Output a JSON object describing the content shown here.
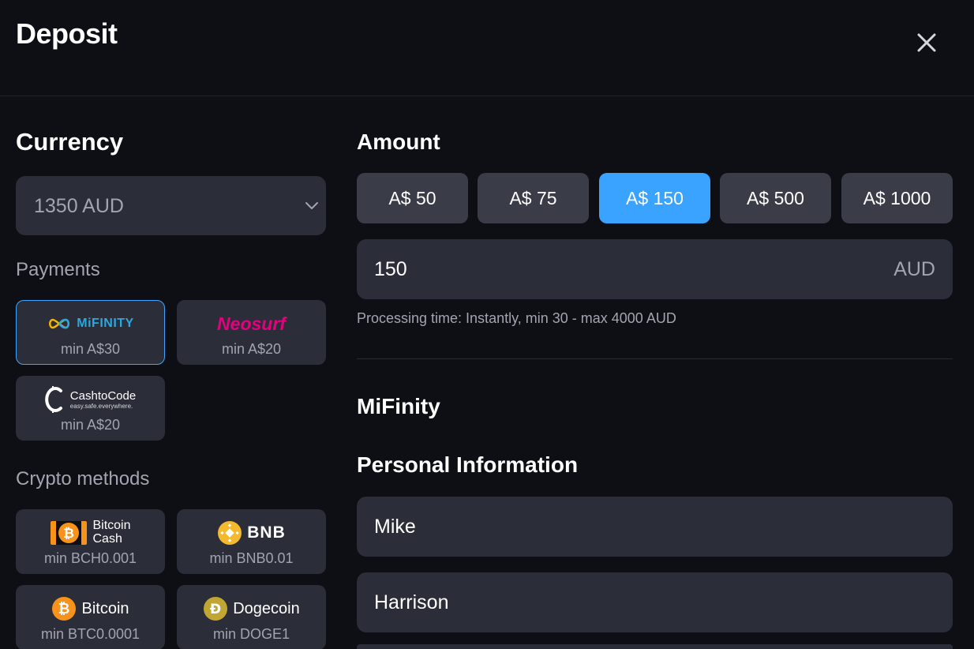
{
  "header": {
    "title": "Deposit",
    "close_icon": "close-icon"
  },
  "currency": {
    "heading": "Currency",
    "selected": "1350 AUD",
    "icon": "chevron-down-icon"
  },
  "payments": {
    "heading": "Payments",
    "methods": [
      {
        "logo_text": "MiFINITY",
        "min": "min A$30",
        "selected": true,
        "color": "#2aa8e0"
      },
      {
        "logo_text": "Neosurf",
        "min": "min A$20",
        "selected": false,
        "color": "#e5007e"
      },
      {
        "logo_text": "CashtoCode",
        "logo_subtext": "easy.safe.everywhere.",
        "min": "min A$20",
        "selected": false
      }
    ]
  },
  "crypto": {
    "heading": "Crypto methods",
    "methods": [
      {
        "logo_text_line1": "Bitcoin",
        "logo_text_line2": "Cash",
        "min": "min BCH0.001",
        "color": "#f7931a"
      },
      {
        "logo_text": "BNB",
        "min": "min BNB0.01",
        "color": "#f3ba2f"
      },
      {
        "logo_text": "Bitcoin",
        "min": "min BTC0.0001",
        "color": "#f7931a"
      },
      {
        "logo_text": "Dogecoin",
        "min": "min DOGE1",
        "color": "#c2a633"
      }
    ]
  },
  "amount": {
    "heading": "Amount",
    "presets": [
      "A$ 50",
      "A$ 75",
      "A$ 150",
      "A$ 500",
      "A$ 1000"
    ],
    "active_index": 2,
    "value": "150",
    "currency_suffix": "AUD",
    "hint": "Processing time: Instantly, min 30 - max 4000 AUD"
  },
  "form": {
    "provider_title": "MiFinity",
    "section_title": "Personal Information",
    "first_name": "Mike",
    "last_name": "Harrison"
  },
  "colors": {
    "accent": "#3aa3ff",
    "background": "#0e0f14",
    "card": "#2b2d38"
  }
}
